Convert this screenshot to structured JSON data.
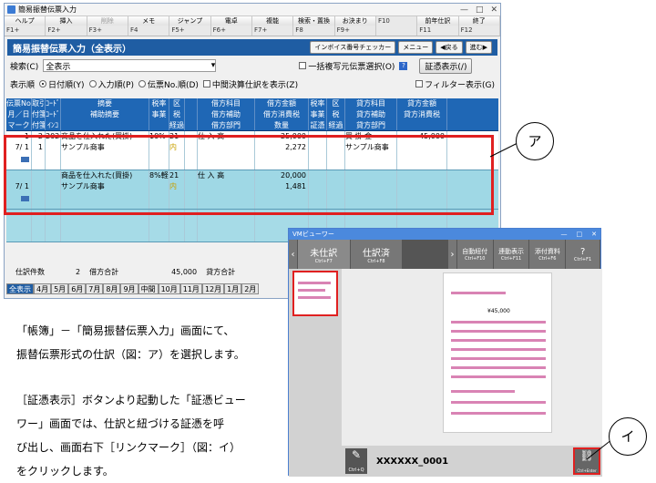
{
  "window": {
    "title": "簡易振替伝票入力"
  },
  "fkeys": [
    {
      "label": "ヘルプ",
      "key": "F1+"
    },
    {
      "label": "挿入",
      "key": "F2+"
    },
    {
      "label": "削除",
      "key": "F3+"
    },
    {
      "label": "メモ",
      "key": "F4"
    },
    {
      "label": "ジャンプ",
      "key": "F5+"
    },
    {
      "label": "電卓",
      "key": "F6+"
    },
    {
      "label": "複能",
      "key": "F7+"
    },
    {
      "label": "検索・置換",
      "key": "F8"
    },
    {
      "label": "お決まり",
      "key": "F9+"
    },
    {
      "label": "",
      "key": "F10"
    },
    {
      "label": "前年仕訳",
      "key": "F11"
    },
    {
      "label": "終了",
      "key": "F12"
    }
  ],
  "header": {
    "title": "簡易振替伝票入力（全表示）",
    "btn_checker": "インボイス番号チェッカー",
    "btn_menu": "メニュー",
    "btn_prev": "◀戻る",
    "btn_next": "進む▶"
  },
  "search": {
    "label": "検索(C)",
    "value": "全表示",
    "bulk": "一括複写元伝票選択(O)",
    "evidence_button": "証憑表示(/)"
  },
  "order": {
    "label": "表示順",
    "opt1": "日付順(Y)",
    "opt2": "入力順(P)",
    "opt3": "伝票No.順(D)",
    "mid": "中間決算仕訳を表示(Z)",
    "filter": "フィルター表示(G)"
  },
  "columns": [
    [
      "伝票No.",
      "月／日",
      "マーク"
    ],
    [
      "取引",
      "付箋1",
      "付箋2"
    ],
    [
      "ｺｰﾄﾞ",
      "ｺｰﾄﾞ",
      "ｲﾝｺ"
    ],
    [
      "摘要",
      "補助摘要",
      ""
    ],
    [
      "税率",
      "事業",
      ""
    ],
    [
      "区",
      "税",
      "経過"
    ],
    [
      "",
      "",
      ""
    ],
    [
      "借方科目",
      "借方補助",
      "借方部門"
    ],
    [
      "借方金額",
      "借方消費税",
      "数量"
    ],
    [
      "税率",
      "事業",
      "証憑"
    ],
    [
      "区",
      "税",
      "経過"
    ],
    [
      "貸方科目",
      "貸方補助",
      "貸方部門"
    ],
    [
      "貸方金額",
      "貸方消費税",
      ""
    ]
  ],
  "rows": [
    {
      "no": "1",
      "tori": "2",
      "code": "202",
      "tekiyo": "商品を仕入れた(買掛)",
      "rate": "10%",
      "ku": "21",
      "zei": "内",
      "kari": "仕 入 高",
      "kari_amt": "25,000",
      "kari_tax": "2,272",
      "date": "7/ 1",
      "mark": "1",
      "hojo": "サンプル商事",
      "kashi": "買 掛 金",
      "kashi_amt": "45,000",
      "kashi_hojo": "サンプル商事"
    },
    {
      "no": "",
      "tori": "",
      "code": "",
      "tekiyo": "商品を仕入れた(買掛)",
      "rate": "8%軽",
      "ku": "21",
      "zei": "内",
      "kari": "仕 入 高",
      "kari_amt": "20,000",
      "kari_tax": "1,481",
      "date": "7/ 1",
      "mark": "",
      "hojo": "サンプル商事",
      "kashi": "",
      "kashi_amt": "",
      "kashi_hojo": ""
    }
  ],
  "footer": {
    "count_label": "仕訳件数",
    "count": "2",
    "debit_label": "借方合計",
    "debit": "45,000",
    "credit_label": "貸方合計"
  },
  "tabs": [
    "全表示",
    "4月",
    "5月",
    "6月",
    "7月",
    "8月",
    "9月",
    "中間",
    "10月",
    "11月",
    "12月",
    "1月",
    "2月"
  ],
  "callouts": {
    "a": "ア",
    "i": "イ"
  },
  "description": {
    "p1a": "「帳簿」－「簡易振替伝票入力」画面にて、",
    "p1b": "振替伝票形式の仕訳（図：ア）を選択します。",
    "p2a": "［証憑表示］ボタンより起動した「証憑ビュー",
    "p2b": "ワー」画面では、仕訳と紐づける証憑を呼",
    "p2c": "び出し、画面右下［リンクマーク］（図：イ）",
    "p2d": "をクリックします。"
  },
  "viewer": {
    "title": "VMビューワー",
    "tab_unlinked": "未仕訳",
    "tab_unlinked_key": "Ctrl+F7",
    "tab_linked": "仕訳済",
    "tab_linked_key": "Ctrl+F8",
    "btn_auto": "自動紐付",
    "btn_auto_key": "Ctrl+F10",
    "btn_link": "連動表示",
    "btn_link_key": "Ctrl+F11",
    "btn_attach": "添付資料",
    "btn_attach_key": "Ctrl+F6",
    "btn_help": "?",
    "btn_help_key": "Ctrl+F1",
    "doc_name": "XXXXXX_0001",
    "pin_label": "Ctrl+Q",
    "link_label": "Ctrl+Enter",
    "amount": "¥45,000"
  }
}
